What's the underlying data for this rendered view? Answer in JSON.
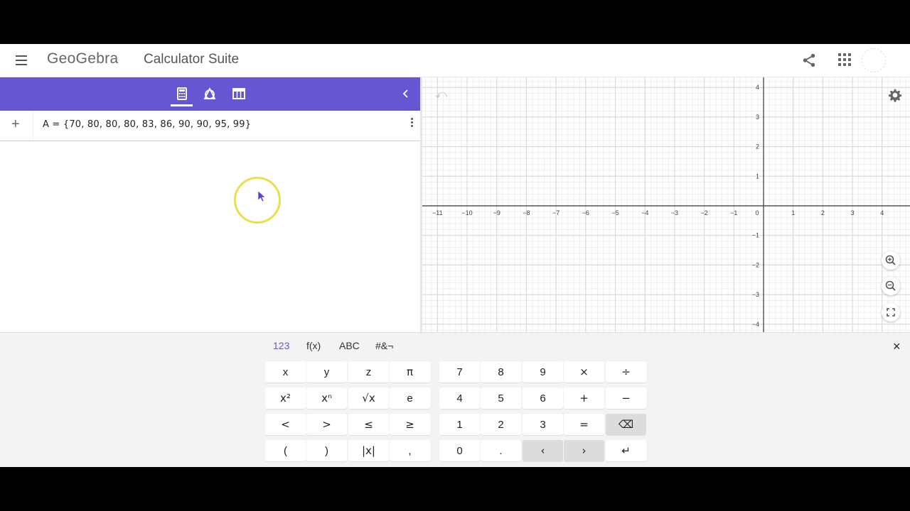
{
  "header": {
    "logo_text": "GeoGebra",
    "suite_title": "Calculator Suite"
  },
  "algebra": {
    "add_label": "+",
    "expression": "A = {70, 80, 80, 80, 83, 86, 90, 90, 95, 99}"
  },
  "graphics": {
    "undo_label": "⤺",
    "x_ticks": [
      "−11",
      "−10",
      "−9",
      "−8",
      "−7",
      "−6",
      "−5",
      "−4",
      "−3",
      "−2",
      "−1",
      "0",
      "1",
      "2",
      "3",
      "4"
    ],
    "y_ticks": [
      "4",
      "3",
      "2",
      "1",
      "−1",
      "−2",
      "−3",
      "−4"
    ]
  },
  "keyboard": {
    "tabs": [
      "123",
      "f(x)",
      "ABC",
      "#&¬"
    ],
    "active_tab": "123",
    "close_label": "×",
    "rows": [
      [
        "x",
        "y",
        "z",
        "π"
      ],
      [
        "x²",
        "xⁿ",
        "√x",
        "e"
      ],
      [
        "<",
        ">",
        "≤",
        "≥"
      ],
      [
        "(",
        ")",
        "|x|",
        ","
      ]
    ],
    "numpad": [
      [
        "7",
        "8",
        "9",
        "×",
        "÷"
      ],
      [
        "4",
        "5",
        "6",
        "+",
        "−"
      ],
      [
        "1",
        "2",
        "3",
        "=",
        "⌫"
      ],
      [
        "0",
        ".",
        "‹",
        "›",
        "↵"
      ]
    ]
  }
}
